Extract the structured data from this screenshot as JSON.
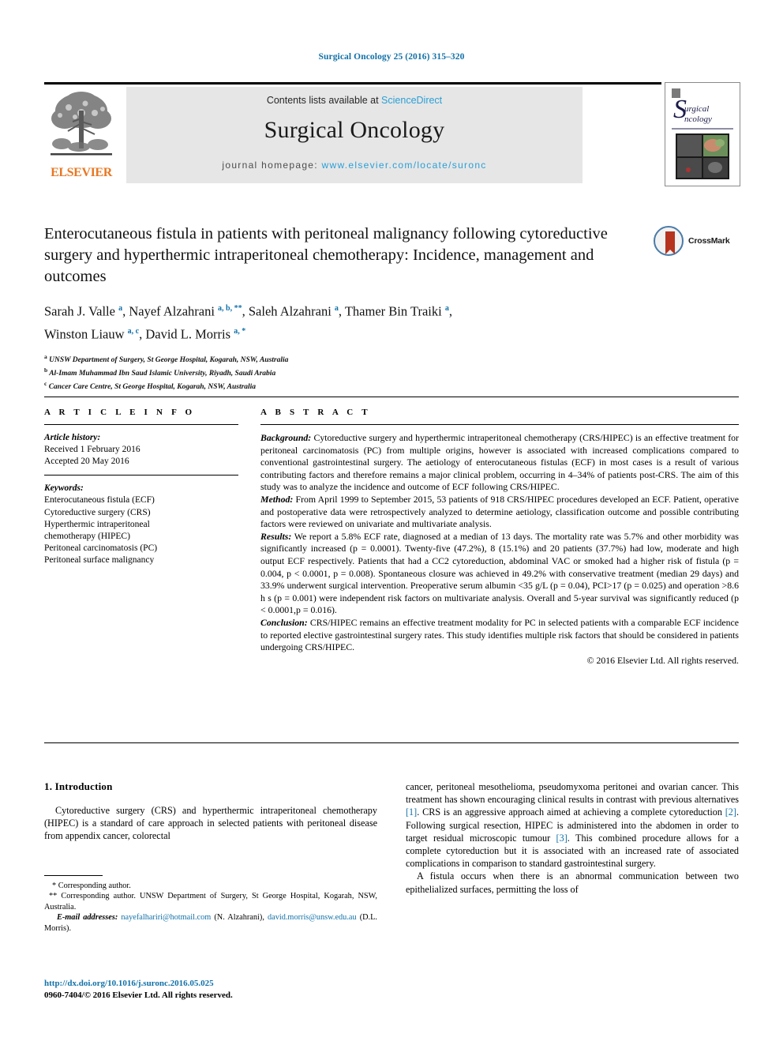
{
  "running_head": "Surgical Oncology 25 (2016) 315–320",
  "masthead": {
    "contents_prefix": "Contents lists available at ",
    "sciencedirect": "ScienceDirect",
    "journal_name": "Surgical Oncology",
    "homepage_prefix": "journal homepage: ",
    "homepage_url": "www.elsevier.com/locate/suronc",
    "publisher": "ELSEVIER",
    "cover_title_line1": "Surgical",
    "cover_title_line2": "Oncology"
  },
  "crossmark": {
    "label": "CrossMark"
  },
  "article": {
    "title": "Enterocutaneous fistula in patients with peritoneal malignancy following cytoreductive surgery and hyperthermic intraperitoneal chemotherapy: Incidence, management and outcomes",
    "authors_line1_pre": "Sarah J. Valle ",
    "authors": "Sarah J. Valle a, Nayef Alzahrani a, b, **, Saleh Alzahrani a, Thamer Bin Traiki a, Winston Liauw a, c, David L. Morris a, *",
    "affiliations": [
      {
        "marker": "a",
        "text": "UNSW Department of Surgery, St George Hospital, Kogarah, NSW, Australia"
      },
      {
        "marker": "b",
        "text": "Al-Imam Muhammad Ibn Saud Islamic University, Riyadh, Saudi Arabia"
      },
      {
        "marker": "c",
        "text": "Cancer Care Centre, St George Hospital, Kogarah, NSW, Australia"
      }
    ]
  },
  "article_info": {
    "heading": "A R T I C L E  I N F O",
    "history_label": "Article history:",
    "received": "Received 1 February 2016",
    "accepted": "Accepted 20 May 2016",
    "keywords_label": "Keywords:",
    "keywords": [
      "Enterocutaneous fistula (ECF)",
      "Cytoreductive surgery (CRS)",
      "Hyperthermic intraperitoneal",
      "chemotherapy (HIPEC)",
      "Peritoneal carcinomatosis (PC)",
      "Peritoneal surface malignancy"
    ]
  },
  "abstract": {
    "heading": "A B S T R A C T",
    "background_label": "Background:",
    "background": " Cytoreductive surgery and hyperthermic intraperitoneal chemotherapy (CRS/HIPEC) is an effective treatment for peritoneal carcinomatosis (PC) from multiple origins, however is associated with increased complications compared to conventional gastrointestinal surgery. The aetiology of enterocutaneous fistulas (ECF) in most cases is a result of various contributing factors and therefore remains a major clinical problem, occurring in 4–34% of patients post-CRS. The aim of this study was to analyze the incidence and outcome of ECF following CRS/HIPEC.",
    "method_label": "Method:",
    "method": " From April 1999 to September 2015, 53 patients of 918 CRS/HIPEC procedures developed an ECF. Patient, operative and postoperative data were retrospectively analyzed to determine aetiology, classification outcome and possible contributing factors were reviewed on univariate and multivariate analysis.",
    "results_label": "Results:",
    "results": " We report a 5.8% ECF rate, diagnosed at a median of 13 days. The mortality rate was 5.7% and other morbidity was significantly increased (p = 0.0001). Twenty-five (47.2%), 8 (15.1%) and 20 patients (37.7%) had low, moderate and high output ECF respectively. Patients that had a CC2 cytoreduction, abdominal VAC or smoked had a higher risk of fistula (p = 0.004, p < 0.0001, p = 0.008). Spontaneous closure was achieved in 49.2% with conservative treatment (median 29 days) and 33.9% underwent surgical intervention. Preoperative serum albumin <35 g/L (p = 0.04), PCI>17 (p = 0.025) and operation >8.6 h s (p = 0.001) were independent risk factors on multivariate analysis. Overall and 5-year survival was significantly reduced (p < 0.0001,p = 0.016).",
    "conclusion_label": "Conclusion:",
    "conclusion": " CRS/HIPEC remains an effective treatment modality for PC in selected patients with a comparable ECF incidence to reported elective gastrointestinal surgery rates. This study identifies multiple risk factors that should be considered in patients undergoing CRS/HIPEC.",
    "copyright": "© 2016 Elsevier Ltd. All rights reserved."
  },
  "introduction": {
    "heading": "1. Introduction",
    "para1_left": "Cytoreductive surgery (CRS) and hyperthermic intraperitoneal chemotherapy (HIPEC) is a standard of care approach in selected patients with peritoneal disease from appendix cancer, colorectal",
    "para1_right_a": "cancer, peritoneal mesothelioma, pseudomyxoma peritonei and ovarian cancer. This treatment has shown encouraging clinical results in contrast with previous alternatives ",
    "ref1": "[1]",
    "para1_right_b": ". CRS is an aggressive approach aimed at achieving a complete cytoreduction ",
    "ref2": "[2]",
    "para1_right_c": ". Following surgical resection, HIPEC is administered into the abdomen in order to target residual microscopic tumour ",
    "ref3": "[3]",
    "para1_right_d": ". This combined procedure allows for a complete cytoreduction but it is associated with an increased rate of associated complications in comparison to standard gastrointestinal surgery.",
    "para2_right": "A fistula occurs when there is an abnormal communication between two epithelialized surfaces, permitting the loss of"
  },
  "footnotes": {
    "corr1": "* Corresponding author.",
    "corr2": "** Corresponding author. UNSW Department of Surgery, St George Hospital, Kogarah, NSW, Australia.",
    "email_label": "E-mail addresses:",
    "email1": "nayefalhariri@hotmail.com",
    "email1_name": " (N. Alzahrani), ",
    "email2": "david.morris@unsw.edu.au",
    "email2_name": " (D.L. Morris).",
    "doi": "http://dx.doi.org/10.1016/j.suronc.2016.05.025",
    "issn": "0960-7404/© 2016 Elsevier Ltd. All rights reserved."
  },
  "colors": {
    "link_blue": "#1171a8",
    "sd_blue": "#2a9fd6",
    "elsevier_orange": "#e87722",
    "band_gray": "#e6e6e6"
  }
}
